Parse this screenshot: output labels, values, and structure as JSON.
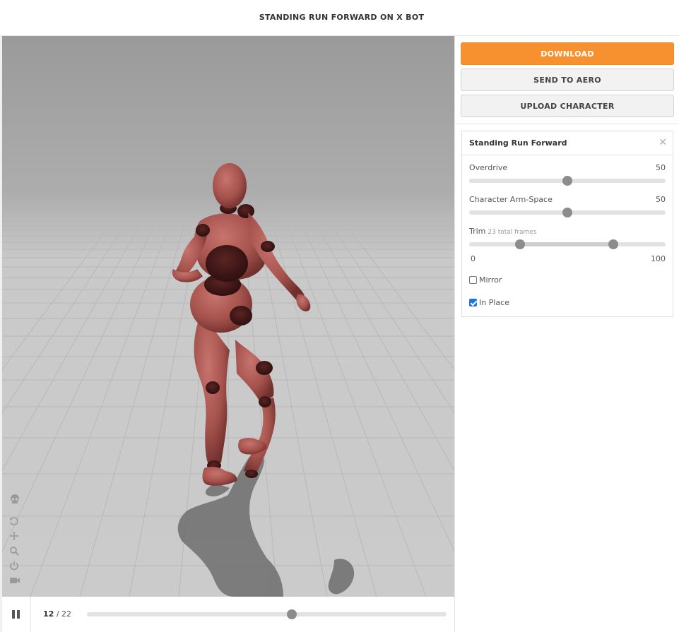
{
  "header": {
    "title": "STANDING RUN FORWARD ON X BOT"
  },
  "viewport_tools": [
    {
      "icon": "skull-icon"
    },
    {
      "icon": "rotate-icon"
    },
    {
      "icon": "move-icon"
    },
    {
      "icon": "zoom-icon"
    },
    {
      "icon": "power-icon"
    },
    {
      "icon": "camera-icon"
    }
  ],
  "playback": {
    "current_frame": "12",
    "separator": "/",
    "total_frames": "22",
    "progress_fraction": 0.57
  },
  "actions": {
    "download_label": "DOWNLOAD",
    "send_label": "SEND TO AERO",
    "upload_label": "UPLOAD CHARACTER"
  },
  "panel": {
    "title": "Standing Run Forward",
    "close_icon": "close-icon",
    "overdrive": {
      "label": "Overdrive",
      "value": "50",
      "fraction": 0.5
    },
    "arm_space": {
      "label": "Character Arm-Space",
      "value": "50",
      "fraction": 0.5
    },
    "trim": {
      "label": "Trim",
      "note": "23 total frames",
      "min_label": "0",
      "max_label": "100",
      "start_fraction": 0.26,
      "end_fraction": 0.735
    },
    "mirror": {
      "label": "Mirror",
      "checked": false
    },
    "in_place": {
      "label": "In Place",
      "checked": true
    }
  },
  "colors": {
    "accent": "#f7912f",
    "character": "#a5524d",
    "checkbox": "#1a73e8"
  }
}
